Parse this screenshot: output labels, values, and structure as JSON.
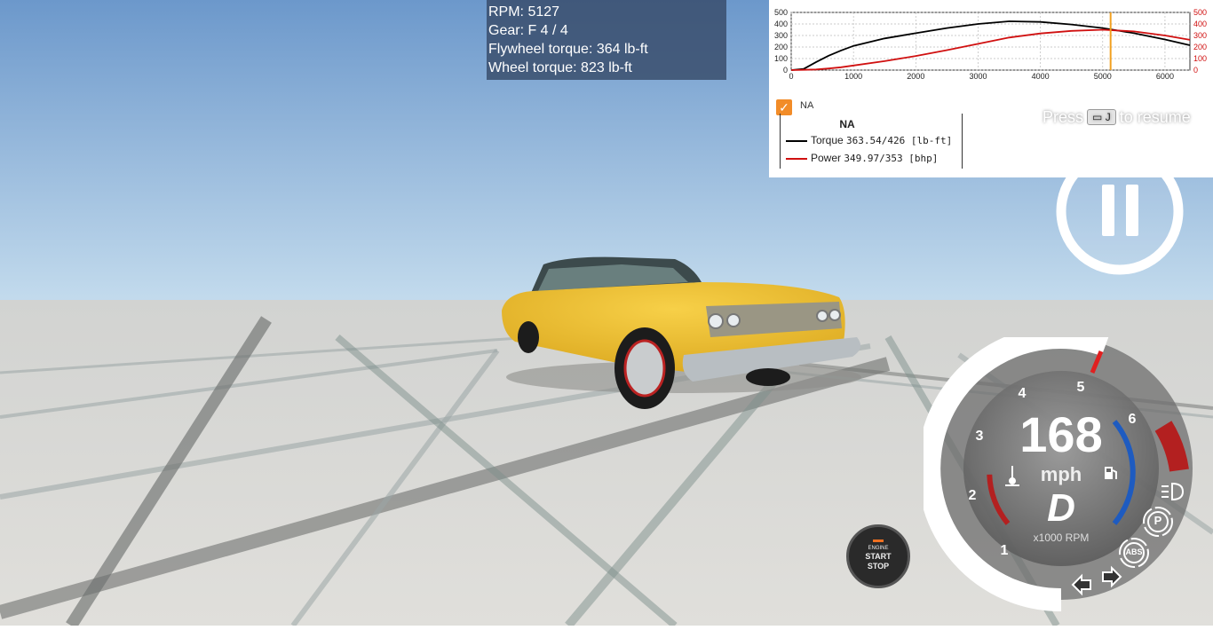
{
  "telemetry": {
    "rpm": "RPM: 5127",
    "gear": "Gear: F 4 / 4",
    "flywheel_torque": "Flywheel torque: 364 lb-ft",
    "wheel_torque": "Wheel torque: 823 lb-ft"
  },
  "chart_data": {
    "type": "line",
    "x_ticks": [
      "0",
      "1000",
      "2000",
      "3000",
      "4000",
      "5000",
      "6000"
    ],
    "y_left_ticks": [
      "500",
      "400",
      "300",
      "200",
      "100",
      "0"
    ],
    "y_right_ticks": [
      "500",
      "400",
      "300",
      "200",
      "100",
      "0"
    ],
    "xlim": [
      0,
      6400
    ],
    "ylim": [
      0,
      500
    ],
    "marker_rpm": 5127,
    "series": [
      {
        "name": "Torque",
        "color": "#000000",
        "x": [
          0,
          200,
          400,
          600,
          800,
          1000,
          1500,
          2000,
          2500,
          3000,
          3500,
          4000,
          4500,
          5000,
          5500,
          6000,
          6400
        ],
        "y": [
          0,
          10,
          70,
          125,
          170,
          210,
          275,
          320,
          365,
          400,
          423,
          418,
          395,
          365,
          320,
          265,
          215
        ]
      },
      {
        "name": "Power",
        "color": "#d01010",
        "x": [
          0,
          200,
          400,
          600,
          800,
          1000,
          1500,
          2000,
          2500,
          3000,
          3500,
          4000,
          4500,
          5000,
          5500,
          6000,
          6400
        ],
        "y": [
          0,
          2,
          5,
          14,
          25,
          40,
          78,
          122,
          173,
          228,
          282,
          318,
          340,
          350,
          335,
          300,
          262
        ]
      }
    ]
  },
  "legend": {
    "checkbox_label": "NA",
    "title": "NA",
    "torque_label": "Torque",
    "torque_value": "363.54/426 [lb-ft]",
    "power_label": "Power",
    "power_value": "349.97/353 [bhp]"
  },
  "resume": {
    "prefix": "Press",
    "key": "▭ J",
    "suffix": "to resume"
  },
  "engine_button": {
    "line1": "ENGINE",
    "line2": "START",
    "line3": "STOP"
  },
  "gauge": {
    "speed": "168",
    "unit": "mph",
    "gear": "D",
    "rpm_unit": "x1000 RPM",
    "ticks": [
      "1",
      "2",
      "3",
      "4",
      "5",
      "6"
    ],
    "abs_label": "ABS",
    "parking_label": "P",
    "rpm_value": 5127,
    "redline_start": 6000
  },
  "colors": {
    "sky_top": "#6f9bcd",
    "sky_bottom": "#bfd7ea",
    "ground": "#d9d8d4",
    "car_body": "#f2c232",
    "accent_orange": "#f28c28"
  }
}
